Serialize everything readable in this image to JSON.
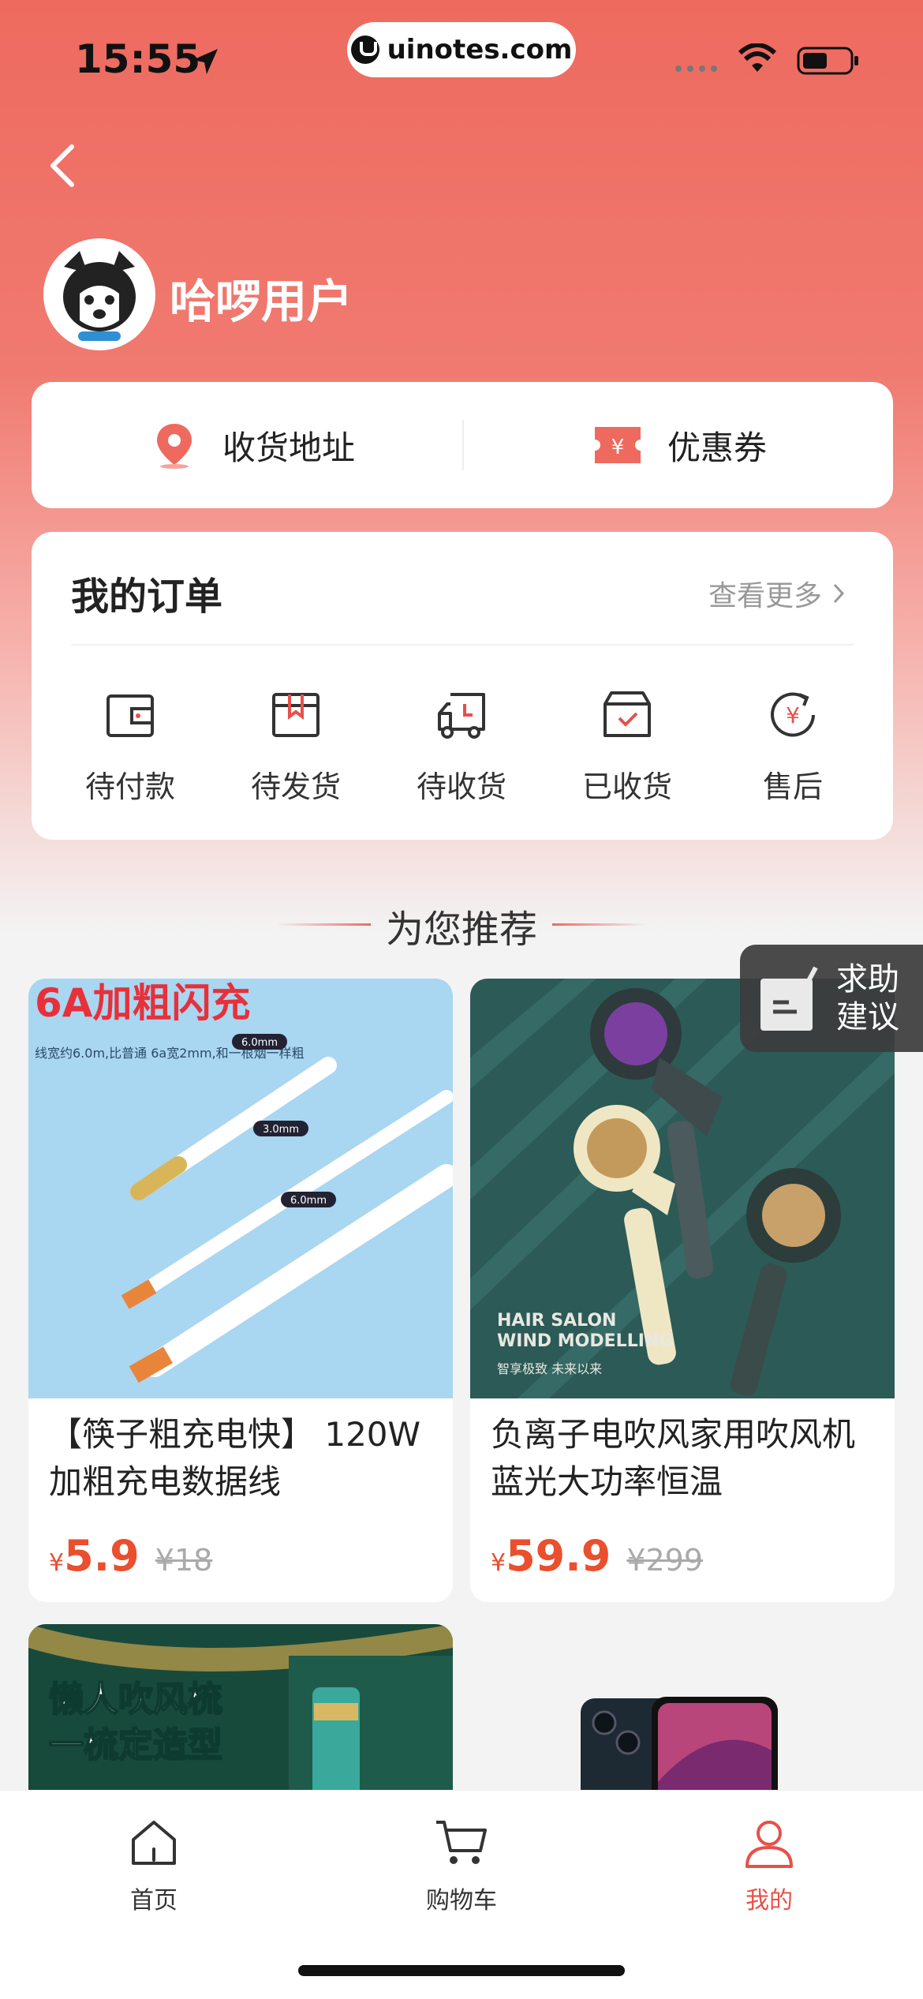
{
  "status_bar": {
    "time": "15:55",
    "url": "uinotes.com"
  },
  "profile": {
    "username": "哈啰用户"
  },
  "quick_links": [
    {
      "label": "收货地址",
      "icon": "location-pin-icon"
    },
    {
      "label": "优惠券",
      "icon": "coupon-icon"
    }
  ],
  "orders": {
    "title": "我的订单",
    "more_label": "查看更多",
    "items": [
      {
        "label": "待付款",
        "icon": "wallet-icon"
      },
      {
        "label": "待发货",
        "icon": "box-icon"
      },
      {
        "label": "待收货",
        "icon": "truck-icon"
      },
      {
        "label": "已收货",
        "icon": "received-box-icon"
      },
      {
        "label": "售后",
        "icon": "refund-icon"
      }
    ]
  },
  "recommend": {
    "title": "为您推荐"
  },
  "help_button": {
    "label": "求助 建议"
  },
  "products": [
    {
      "name": "【筷子粗充电快】 120W加粗充电数据线",
      "price": "5.9",
      "original_price": "¥18",
      "currency": "¥",
      "image_text": {
        "headline": "6A加粗闪充",
        "desc": "线宽约6.0m,比普通 6a宽2mm,和一根烟一样粗",
        "label_1": "6.0mm",
        "label_2": "3.0mm",
        "label_3": "6.0mm"
      }
    },
    {
      "name": "负离子电吹风家用吹风机蓝光大功率恒温",
      "price": "59.9",
      "original_price": "¥299",
      "currency": "¥",
      "image_text": {
        "line1": "HAIR SALON",
        "line2": "WIND MODELLING",
        "line3": "智享极致 未来以来"
      }
    },
    {
      "image_text": {
        "line1": "懒人吹风梳",
        "line2": "一梳定造型"
      }
    },
    {}
  ],
  "tabbar": [
    {
      "label": "首页",
      "icon": "home-icon",
      "active": false
    },
    {
      "label": "购物车",
      "icon": "cart-icon",
      "active": false
    },
    {
      "label": "我的",
      "icon": "user-icon",
      "active": true
    }
  ],
  "colors": {
    "accent": "#e8504a",
    "price": "#ea4f2e"
  }
}
